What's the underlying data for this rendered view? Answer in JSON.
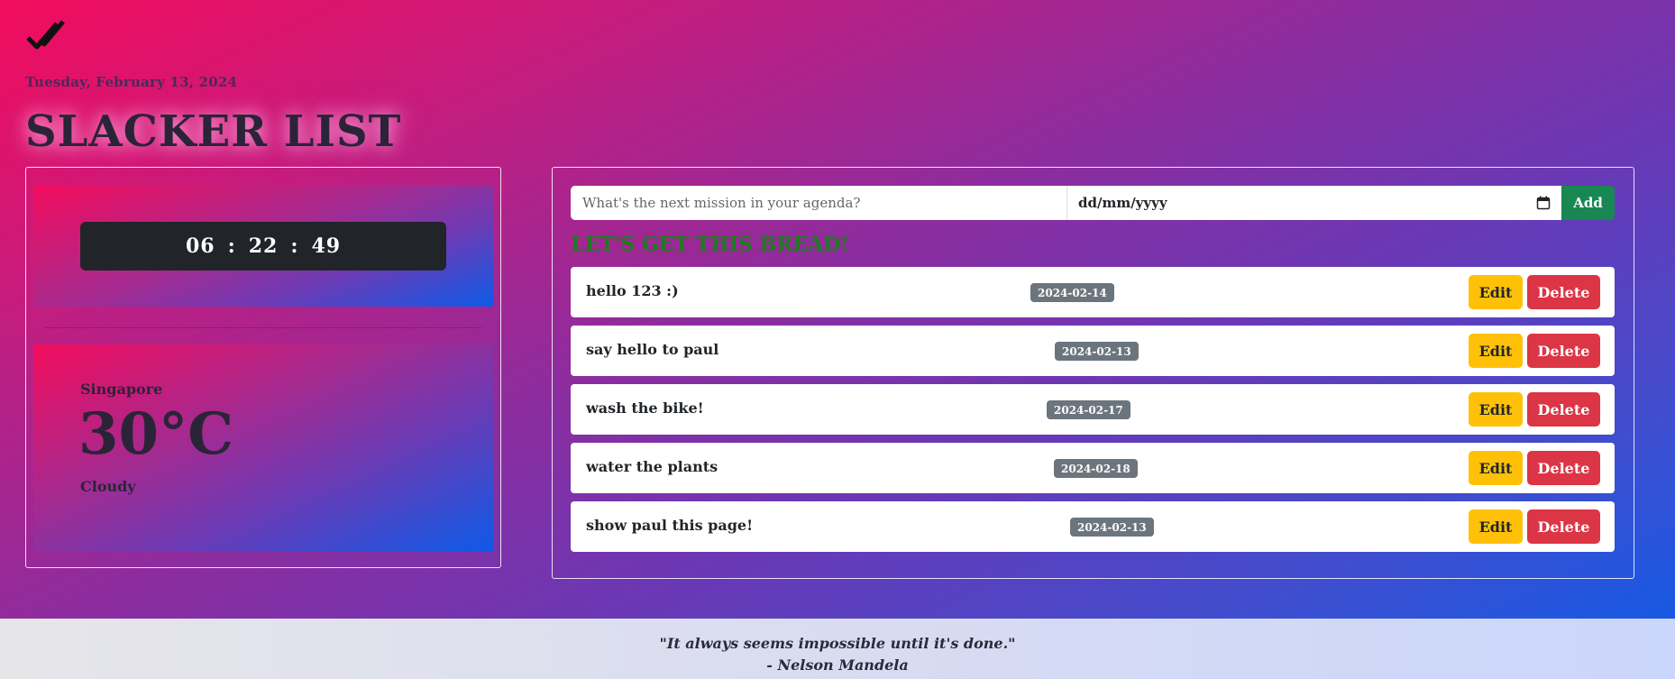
{
  "header": {
    "logo_icon": "double-check-icon",
    "date": "Tuesday, February 13, 2024",
    "title": "SLACKER LIST"
  },
  "clock": {
    "hours": "06",
    "minutes": "22",
    "seconds": "49",
    "separator": ":"
  },
  "weather": {
    "city": "Singapore",
    "temperature": "30°C",
    "condition": "Cloudy"
  },
  "form": {
    "task_placeholder": "What's the next mission in your agenda?",
    "task_value": "",
    "date_placeholder": "dd/mm/yyyy",
    "calendar_icon": "calendar-icon",
    "add_label": "Add"
  },
  "list": {
    "heading": "LET'S GET THIS BREAD!",
    "edit_label": "Edit",
    "delete_label": "Delete",
    "items": [
      {
        "text": "hello 123 :)",
        "date": "2024-02-14"
      },
      {
        "text": "say hello to paul",
        "date": "2024-02-13"
      },
      {
        "text": "wash the bike!",
        "date": "2024-02-17"
      },
      {
        "text": "water the plants",
        "date": "2024-02-18"
      },
      {
        "text": "show paul this page!",
        "date": "2024-02-13"
      }
    ]
  },
  "footer": {
    "quote": "\"It always seems impossible until it's done.\"",
    "author": "- Nelson Mandela"
  },
  "colors": {
    "gradient_start": "#f20c5c",
    "gradient_end": "#0b5cea",
    "add_button": "#198754",
    "edit_button": "#ffc107",
    "delete_button": "#dc3545",
    "badge": "#6c757d",
    "heading_green": "#1f7a1f"
  }
}
